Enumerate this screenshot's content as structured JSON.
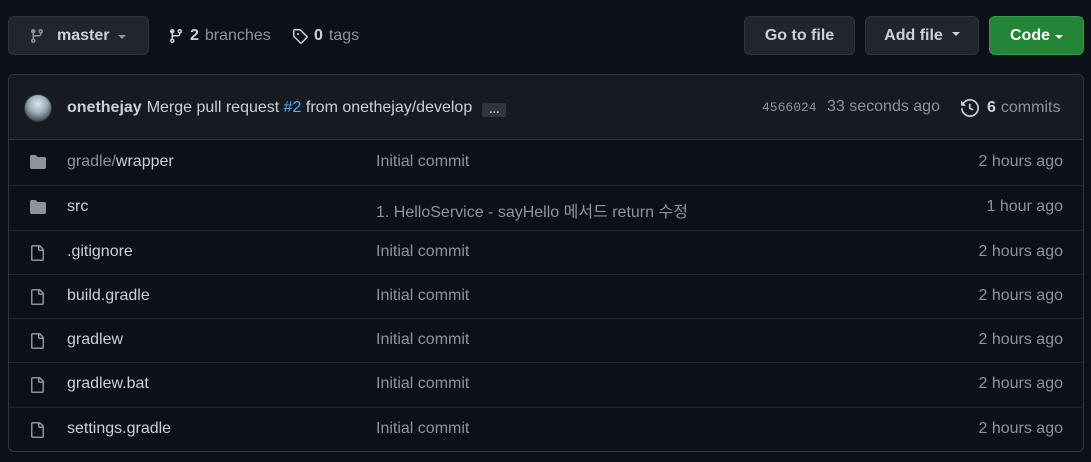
{
  "toolbar": {
    "branch_label": "master",
    "branches_count": "2",
    "branches_label": "branches",
    "tags_count": "0",
    "tags_label": "tags",
    "goto_file_label": "Go to file",
    "add_file_label": "Add file",
    "code_label": "Code"
  },
  "latest_commit": {
    "author": "onethejay",
    "message_prefix": "Merge pull request ",
    "pr_link": "#2",
    "message_suffix": " from onethejay/develop",
    "ellipsis": "…",
    "sha": "4566024",
    "time": "33 seconds ago",
    "commits_count": "6",
    "commits_label": "commits"
  },
  "files": [
    {
      "type": "folder",
      "name_prefix": "gradle/",
      "name": "wrapper",
      "message": "Initial commit",
      "time": "2 hours ago"
    },
    {
      "type": "folder",
      "name_prefix": "",
      "name": "src",
      "message": "1. HelloService - sayHello 메서드 return 수정",
      "time": "1 hour ago"
    },
    {
      "type": "file",
      "name_prefix": "",
      "name": ".gitignore",
      "message": "Initial commit",
      "time": "2 hours ago"
    },
    {
      "type": "file",
      "name_prefix": "",
      "name": "build.gradle",
      "message": "Initial commit",
      "time": "2 hours ago"
    },
    {
      "type": "file",
      "name_prefix": "",
      "name": "gradlew",
      "message": "Initial commit",
      "time": "2 hours ago"
    },
    {
      "type": "file",
      "name_prefix": "",
      "name": "gradlew.bat",
      "message": "Initial commit",
      "time": "2 hours ago"
    },
    {
      "type": "file",
      "name_prefix": "",
      "name": "settings.gradle",
      "message": "Initial commit",
      "time": "2 hours ago"
    }
  ],
  "colors": {
    "background": "#0d1117",
    "code_button": "#238636",
    "link": "#58a6ff"
  }
}
